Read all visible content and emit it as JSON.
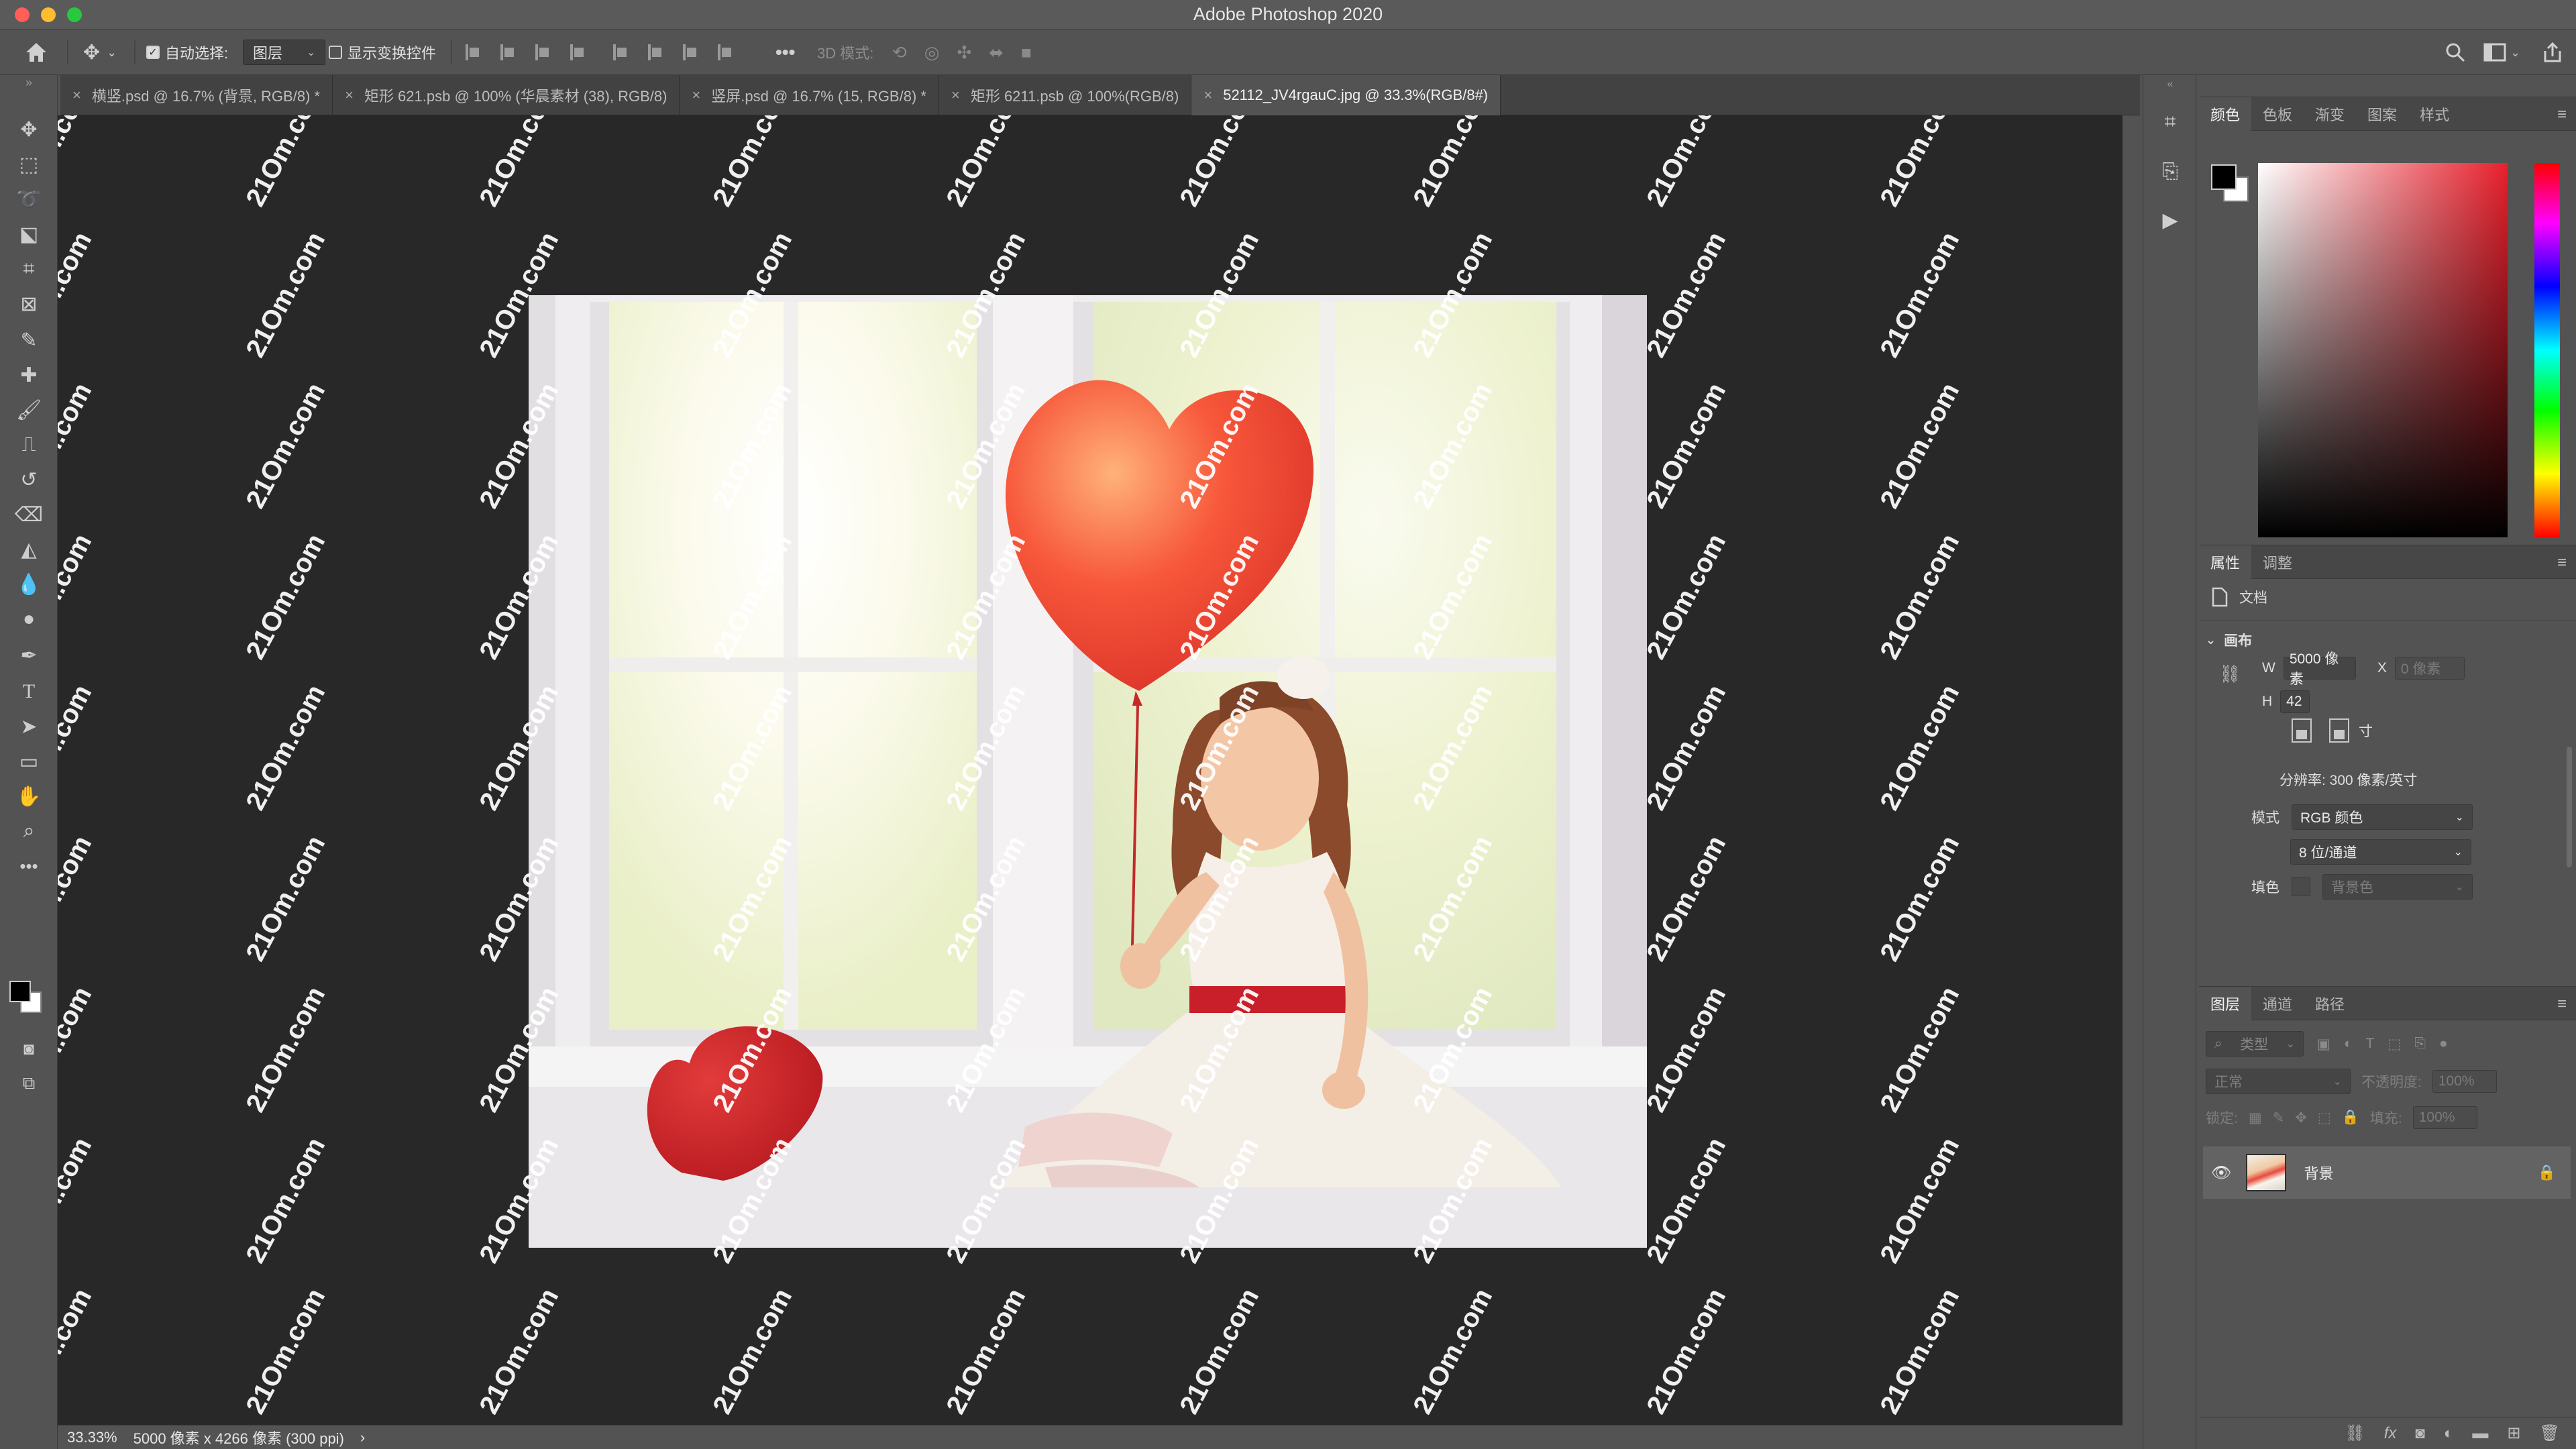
{
  "app": {
    "title": "Adobe Photoshop 2020"
  },
  "window": {
    "controls": {
      "close_color": "#ff5f57",
      "minimize_color": "#febc2e",
      "maximize_color": "#28c840"
    }
  },
  "options_bar": {
    "home_icon": "home-icon",
    "move_icon": "move-tool-icon",
    "auto_select_label": "自动选择:",
    "auto_select_checked": true,
    "auto_select_target": "图层",
    "show_transform_label": "显示变换控件",
    "show_transform_checked": false,
    "more_label": "•••",
    "mode_3d_label": "3D 模式:"
  },
  "tabs": [
    {
      "label": "横竖.psd @ 16.7% (背景, RGB/8) *",
      "active": false
    },
    {
      "label": "矩形 621.psb @ 100% (华晨素材 (38), RGB/8)",
      "active": false
    },
    {
      "label": "竖屏.psd @ 16.7% (15, RGB/8) *",
      "active": false
    },
    {
      "label": "矩形 6211.psb @ 100%(RGB/8)",
      "active": false
    },
    {
      "label": "52112_JV4rgauC.jpg @ 33.3%(RGB/8#)",
      "active": true
    }
  ],
  "tab_close_glyph": "×",
  "toolbar": {
    "tools": [
      "move-tool-icon",
      "marquee-tool-icon",
      "lasso-tool-icon",
      "object-select-tool-icon",
      "crop-tool-icon",
      "frame-tool-icon",
      "eyedropper-tool-icon",
      "healing-brush-tool-icon",
      "brush-tool-icon",
      "clone-stamp-tool-icon",
      "history-brush-tool-icon",
      "eraser-tool-icon",
      "paint-bucket-tool-icon",
      "blur-tool-icon",
      "dodge-tool-icon",
      "pen-tool-icon",
      "type-tool-icon",
      "path-select-tool-icon",
      "rectangle-tool-icon",
      "hand-tool-icon",
      "zoom-tool-icon",
      "more-tools-icon"
    ],
    "foreground_color": "#000000",
    "background_color": "#ffffff",
    "type_glyph": "T"
  },
  "canvas": {
    "background": "#282828",
    "watermark_text": "21Om.com"
  },
  "status_bar": {
    "zoom": "33.33%",
    "doc_info": "5000 像素 x 4266 像素 (300 ppi)",
    "arrow": "›"
  },
  "panels": {
    "color": {
      "tabs": [
        "颜色",
        "色板",
        "渐变",
        "图案",
        "样式"
      ],
      "active_tab": "颜色",
      "hue_color": "#e8202c"
    },
    "properties": {
      "tabs": [
        "属性",
        "调整"
      ],
      "active_tab": "属性",
      "doc_label": "文档",
      "section": "画布",
      "width_label": "W",
      "width_value": "5000 像素",
      "x_label": "X",
      "x_value": "0 像素",
      "height_label": "H",
      "height_value": "42",
      "y_suffix": "寸",
      "resolution": "分辨率: 300 像素/英寸",
      "mode_label": "模式",
      "mode_value": "RGB 颜色",
      "depth_value": "8 位/通道",
      "fill_label": "填色",
      "fill_value": "背景色"
    },
    "layers": {
      "tabs": [
        "图层",
        "通道",
        "路径"
      ],
      "active_tab": "图层",
      "filter_placeholder": "类型",
      "blend_mode": "正常",
      "opacity_label": "不透明度:",
      "opacity_value": "100%",
      "lock_label": "锁定:",
      "fill_label": "填充:",
      "fill_value": "100%",
      "layer_name": "背景"
    }
  }
}
